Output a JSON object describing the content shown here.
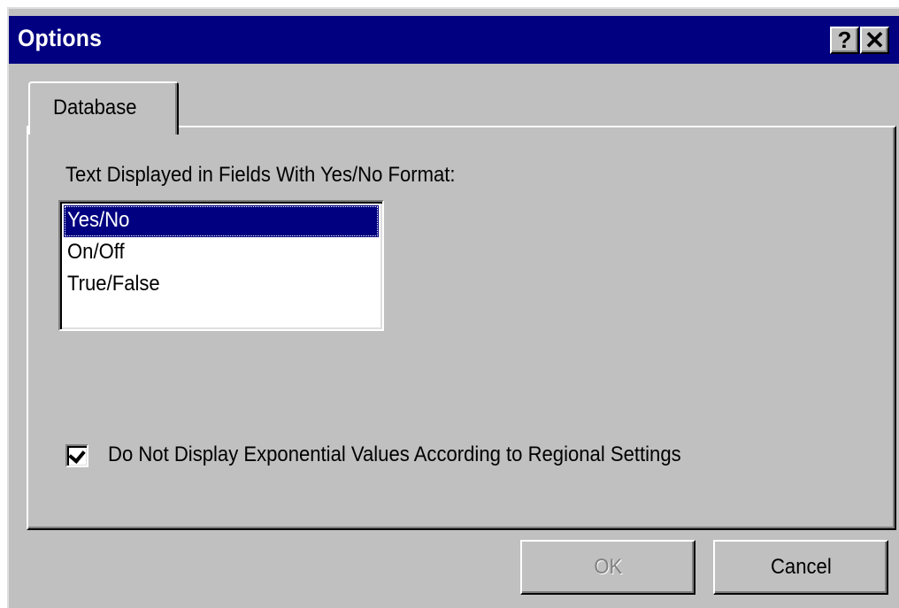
{
  "window": {
    "title": "Options",
    "help_label": "?",
    "close_label": "✕"
  },
  "tabs": [
    {
      "label": "Database",
      "active": true
    }
  ],
  "database": {
    "yesno_label": "Text Displayed in Fields With Yes/No Format:",
    "yesno_options": [
      "Yes/No",
      "On/Off",
      "True/False"
    ],
    "yesno_selected": "Yes/No",
    "exponential_label": "Do Not Display Exponential Values According to Regional Settings",
    "exponential_checked": true
  },
  "buttons": {
    "ok_label": "OK",
    "ok_enabled": false,
    "cancel_label": "Cancel"
  },
  "colors": {
    "titlebar": "#000080",
    "face": "#c0c0c0",
    "selection": "#000080"
  }
}
